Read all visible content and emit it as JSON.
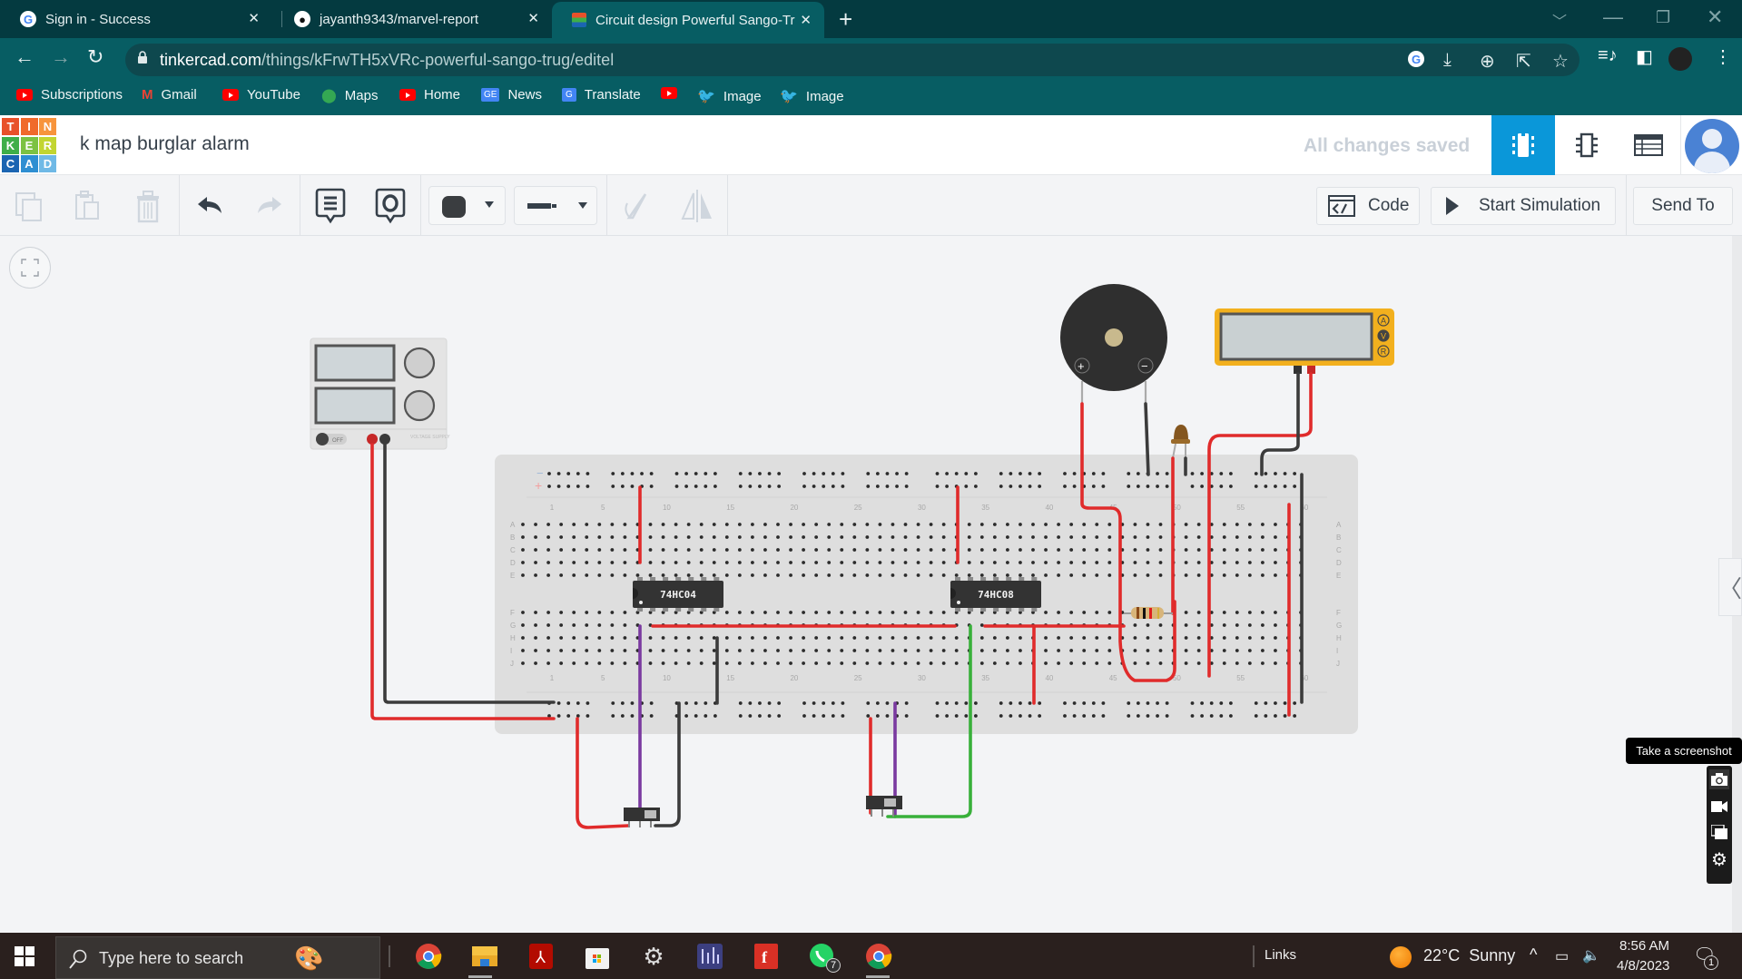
{
  "browser": {
    "tabs": [
      {
        "title": "Sign in - Success",
        "icon": "google-icon",
        "active": false
      },
      {
        "title": "jayanth9343/marvel-report",
        "icon": "github-icon",
        "active": false
      },
      {
        "title": "Circuit design Powerful Sango-Tr",
        "icon": "tinkercad-icon",
        "active": true
      }
    ],
    "new_tab_label": "+",
    "url_host": "tinkercad.com",
    "url_path": "/things/kFrwTH5xVRc-powerful-sango-trug/editel",
    "bookmarks": [
      {
        "label": "Subscriptions",
        "icon": "youtube-icon"
      },
      {
        "label": "Gmail",
        "icon": "gmail-icon"
      },
      {
        "label": "YouTube",
        "icon": "youtube-icon"
      },
      {
        "label": "Maps",
        "icon": "maps-icon"
      },
      {
        "label": "Home",
        "icon": "youtube-icon"
      },
      {
        "label": "News",
        "icon": "google-news-icon"
      },
      {
        "label": "Translate",
        "icon": "google-translate-icon"
      },
      {
        "label": "",
        "icon": "youtube-icon"
      },
      {
        "label": "Image",
        "icon": "twitter-icon"
      },
      {
        "label": "Image",
        "icon": "twitter-icon"
      }
    ]
  },
  "app": {
    "logo_letters": [
      "T",
      "I",
      "N",
      "K",
      "E",
      "R",
      "C",
      "A",
      "D"
    ],
    "logo_colors": [
      "#e8512a",
      "#f06a2b",
      "#f7943c",
      "#3fae49",
      "#7cc242",
      "#c2d531",
      "#1b65b2",
      "#2e8fd2",
      "#6fb9e6"
    ],
    "project_title": "k map burglar alarm",
    "save_status": "All changes saved",
    "accent_color": "#0a97d9"
  },
  "toolbar": {
    "code_label": "Code",
    "start_simulation_label": "Start Simulation",
    "send_to_label": "Send To",
    "wire_color": "#3a3d40"
  },
  "circuit": {
    "chips": [
      {
        "label": "74HC04",
        "type": "hex-inverter"
      },
      {
        "label": "74HC08",
        "type": "quad-and-gate"
      }
    ],
    "breadboard": {
      "row_letters_top": [
        "A",
        "B",
        "C",
        "D",
        "E"
      ],
      "row_letters_bottom": [
        "F",
        "G",
        "H",
        "I",
        "J"
      ],
      "column_labels": [
        "1",
        "5",
        "10",
        "15",
        "20",
        "25",
        "30",
        "35",
        "40",
        "45",
        "50",
        "55",
        "60"
      ],
      "columns": 60
    },
    "power_supply": {
      "switch_label": "OFF",
      "caption": "VOLTAGE SUPPLY"
    },
    "multimeter": {
      "modes": [
        "A",
        "V",
        "R"
      ],
      "selected_mode": "V"
    },
    "buzzer": {
      "plus": "+",
      "minus": "−"
    }
  },
  "screenshot_tool": {
    "tooltip": "Take a screenshot"
  },
  "taskbar": {
    "search_placeholder": "Type here to search",
    "links_label": "Links",
    "weather": "22°C  Sunny",
    "time": "8:56 AM",
    "date": "4/8/2023",
    "whatsapp_badge": "7",
    "notification_count": "1"
  }
}
